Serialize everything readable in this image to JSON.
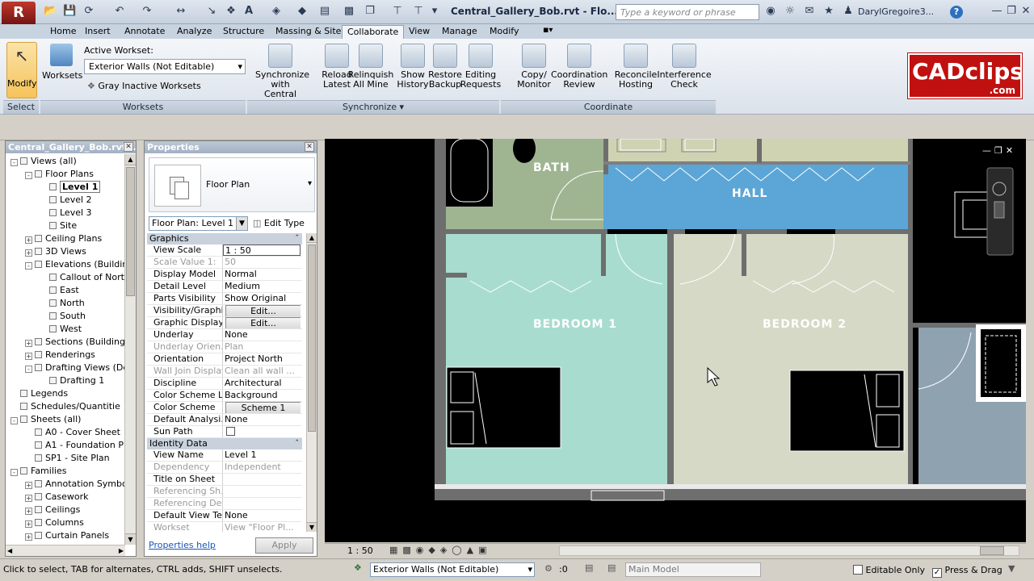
{
  "app": {
    "logo_letter": "R",
    "doc_title": "Central_Gallery_Bob.rvt - Flo...",
    "search_placeholder": "Type a keyword or phrase",
    "user": "DarylGregoire3...",
    "help": "?"
  },
  "tabs": [
    "Home",
    "Insert",
    "Annotate",
    "Analyze",
    "Structure",
    "Massing & Site",
    "Collaborate",
    "View",
    "Manage",
    "Modify"
  ],
  "active_tab": "Collaborate",
  "ribbon": {
    "modify_label": "Modify",
    "select_label": "Select",
    "worksets_label": "Worksets",
    "active_workset_label": "Active Workset:",
    "active_workset_value": "Exterior Walls (Not Editable)",
    "gray_inactive": "Gray Inactive Worksets",
    "worksets_panel": "Worksets",
    "sync_buttons": [
      {
        "line1": "Synchronize",
        "line2": "with Central"
      },
      {
        "line1": "Reload",
        "line2": "Latest"
      },
      {
        "line1": "Relinquish",
        "line2": "All Mine"
      },
      {
        "line1": "Show",
        "line2": "History"
      },
      {
        "line1": "Restore",
        "line2": "Backup"
      },
      {
        "line1": "Editing",
        "line2": "Requests"
      }
    ],
    "synchronize_panel": "Synchronize",
    "coord_buttons": [
      {
        "line1": "Copy/",
        "line2": "Monitor"
      },
      {
        "line1": "Coordination",
        "line2": "Review"
      },
      {
        "line1": "Reconcile",
        "line2": "Hosting"
      },
      {
        "line1": "Interference",
        "line2": "Check"
      }
    ],
    "coordinate_panel": "Coordinate",
    "brand": "CADclips",
    "brand_sub": ".com"
  },
  "browser": {
    "title": "Central_Gallery_Bob.rvt...",
    "items": [
      {
        "label": "Views (all)",
        "level": 0,
        "toggle": "-"
      },
      {
        "label": "Floor Plans",
        "level": 1,
        "toggle": "-"
      },
      {
        "label": "Level 1",
        "level": 2,
        "toggle": "",
        "selected": true
      },
      {
        "label": "Level 2",
        "level": 2,
        "toggle": ""
      },
      {
        "label": "Level 3",
        "level": 2,
        "toggle": ""
      },
      {
        "label": "Site",
        "level": 2,
        "toggle": ""
      },
      {
        "label": "Ceiling Plans",
        "level": 1,
        "toggle": "+"
      },
      {
        "label": "3D Views",
        "level": 1,
        "toggle": "+"
      },
      {
        "label": "Elevations (Buildin",
        "level": 1,
        "toggle": "-"
      },
      {
        "label": "Callout of Nort",
        "level": 2,
        "toggle": ""
      },
      {
        "label": "East",
        "level": 2,
        "toggle": ""
      },
      {
        "label": "North",
        "level": 2,
        "toggle": ""
      },
      {
        "label": "South",
        "level": 2,
        "toggle": ""
      },
      {
        "label": "West",
        "level": 2,
        "toggle": ""
      },
      {
        "label": "Sections (Building",
        "level": 1,
        "toggle": "+"
      },
      {
        "label": "Renderings",
        "level": 1,
        "toggle": "+"
      },
      {
        "label": "Drafting Views (De",
        "level": 1,
        "toggle": "-"
      },
      {
        "label": "Drafting 1",
        "level": 2,
        "toggle": ""
      },
      {
        "label": "Legends",
        "level": 0,
        "toggle": ""
      },
      {
        "label": "Schedules/Quantitie",
        "level": 0,
        "toggle": ""
      },
      {
        "label": "Sheets (all)",
        "level": 0,
        "toggle": "-"
      },
      {
        "label": "A0 - Cover Sheet",
        "level": 1,
        "toggle": ""
      },
      {
        "label": "A1 - Foundation Pla",
        "level": 1,
        "toggle": ""
      },
      {
        "label": "SP1 - Site Plan",
        "level": 1,
        "toggle": ""
      },
      {
        "label": "Families",
        "level": 0,
        "toggle": "-"
      },
      {
        "label": "Annotation Symbo",
        "level": 1,
        "toggle": "+"
      },
      {
        "label": "Casework",
        "level": 1,
        "toggle": "+"
      },
      {
        "label": "Ceilings",
        "level": 1,
        "toggle": "+"
      },
      {
        "label": "Columns",
        "level": 1,
        "toggle": "+"
      },
      {
        "label": "Curtain Panels",
        "level": 1,
        "toggle": "+"
      }
    ]
  },
  "properties": {
    "title": "Properties",
    "type_name": "Floor Plan",
    "selector": "Floor Plan: Level 1",
    "edit_type": "Edit Type",
    "group_graphics": "Graphics",
    "graphics": [
      {
        "k": "View Scale",
        "v": "1 : 50",
        "box": true
      },
      {
        "k": "Scale Value    1:",
        "v": "50",
        "dis": true
      },
      {
        "k": "Display Model",
        "v": "Normal"
      },
      {
        "k": "Detail Level",
        "v": "Medium"
      },
      {
        "k": "Parts Visibility",
        "v": "Show Original"
      },
      {
        "k": "Visibility/Graphi...",
        "v": "Edit...",
        "btn": true
      },
      {
        "k": "Graphic Display...",
        "v": "Edit...",
        "btn": true
      },
      {
        "k": "Underlay",
        "v": "None"
      },
      {
        "k": "Underlay Orien...",
        "v": "Plan",
        "dis": true
      },
      {
        "k": "Orientation",
        "v": "Project North"
      },
      {
        "k": "Wall Join Display",
        "v": "Clean all wall ...",
        "dis": true
      },
      {
        "k": "Discipline",
        "v": "Architectural"
      },
      {
        "k": "Color Scheme L...",
        "v": "Background"
      },
      {
        "k": "Color Scheme",
        "v": "Scheme 1",
        "btn": true
      },
      {
        "k": "Default Analysi...",
        "v": "None"
      },
      {
        "k": "Sun Path",
        "v": "",
        "check": true
      }
    ],
    "group_identity": "Identity Data",
    "identity": [
      {
        "k": "View Name",
        "v": "Level 1"
      },
      {
        "k": "Dependency",
        "v": "Independent",
        "dis": true
      },
      {
        "k": "Title on Sheet",
        "v": ""
      },
      {
        "k": "Referencing Sh...",
        "v": "",
        "dis": true
      },
      {
        "k": "Referencing Detail",
        "v": "",
        "dis": true
      },
      {
        "k": "Default View Te...",
        "v": "None"
      },
      {
        "k": "Workset",
        "v": "View \"Floor Pl...",
        "dis": true
      }
    ],
    "help_link": "Properties help",
    "apply": "Apply"
  },
  "canvas": {
    "rooms": [
      "BATH",
      "HALL",
      "BEDROOM 1",
      "BEDROOM 2"
    ],
    "colors": {
      "bath": "#9fb592",
      "hall": "#5ba6d6",
      "bed1": "#a8dccf",
      "bed2": "#d5d9c6",
      "side": "#8ea2b0",
      "top": "#cfd3b2",
      "wall": "#6e6e6e"
    }
  },
  "view_control": {
    "scale": "1 : 50"
  },
  "status": {
    "hint": "Click to select, TAB for alternates, CTRL adds, SHIFT unselects.",
    "workset": "Exterior Walls (Not Editable)",
    "count": ":0",
    "model": "Main Model",
    "editable_only": "Editable Only",
    "press_drag": "Press & Drag"
  }
}
